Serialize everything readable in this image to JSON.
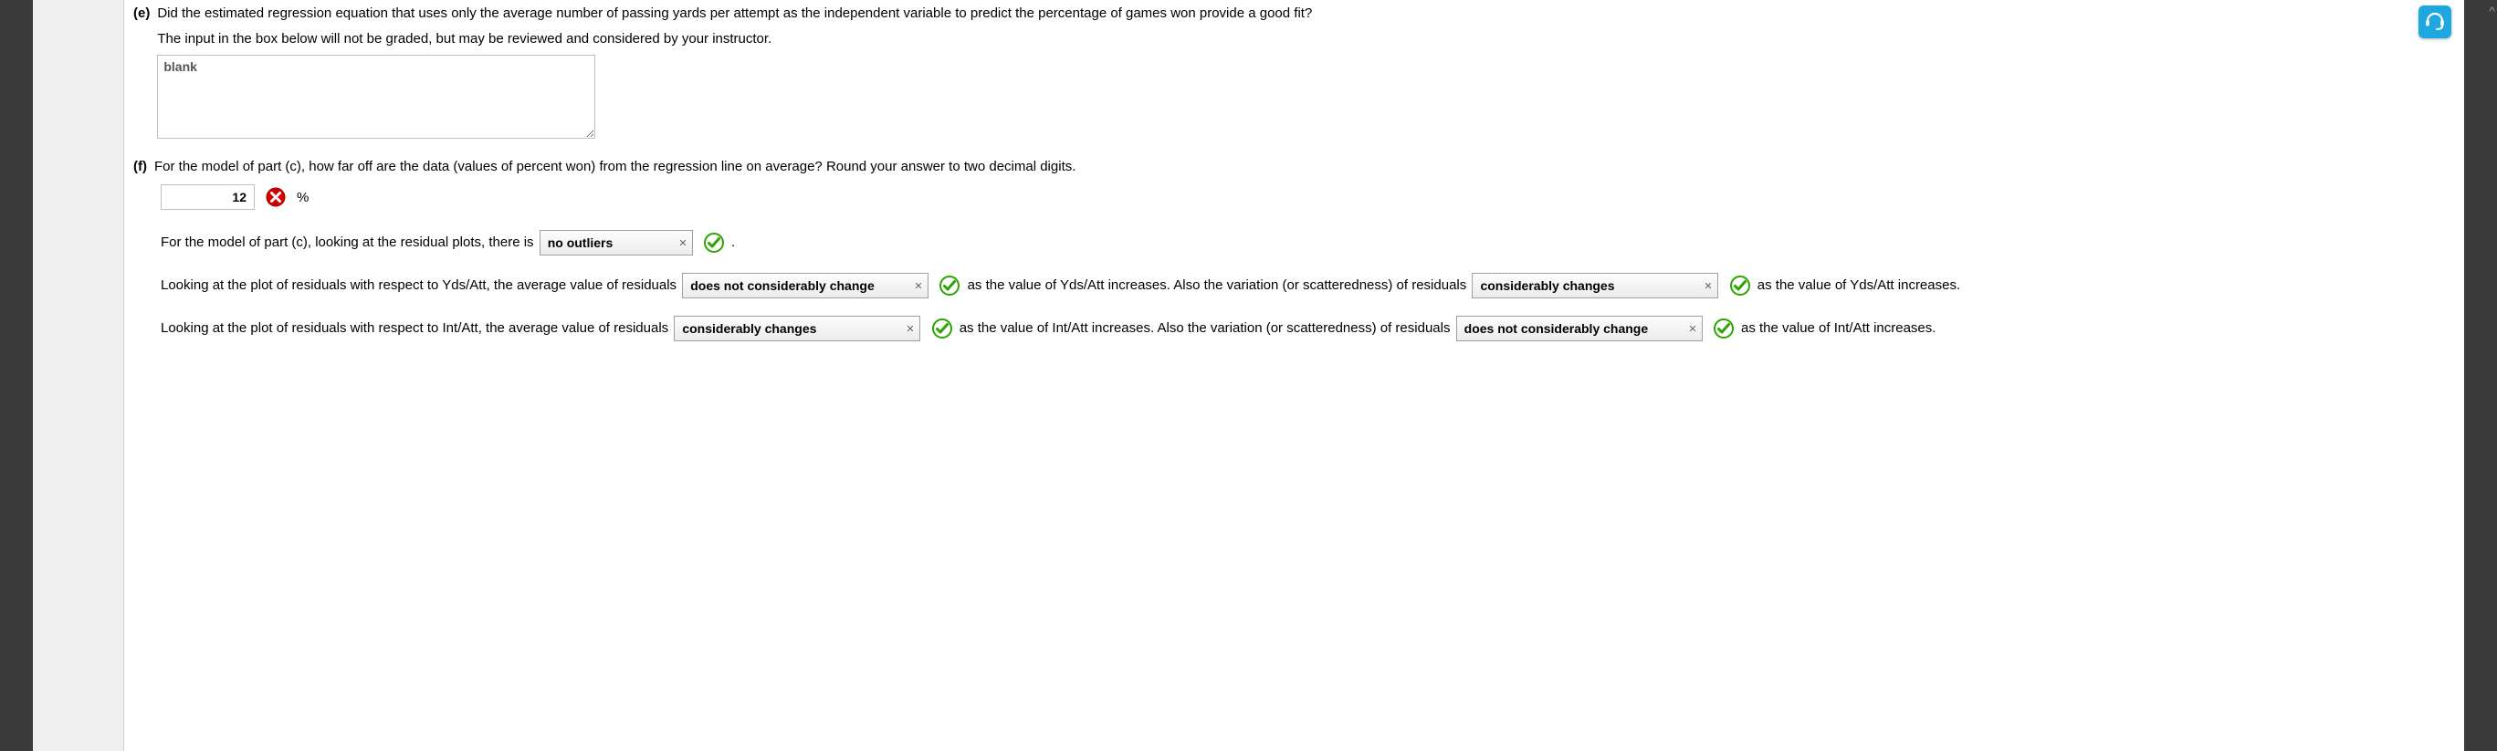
{
  "e": {
    "label": "(e)",
    "question": "Did the estimated regression equation that uses only the average number of passing yards per attempt as the independent variable to predict the percentage of games won provide a good fit?",
    "note": "The input in the box below will not be graded, but may be reviewed and considered by your instructor.",
    "textarea_value": "blank"
  },
  "f": {
    "label": "(f)",
    "question": "For the model of part (c), how far off are the data (values of percent won) from the regression line on average? Round your answer to two decimal digits.",
    "num_value": "12",
    "pct": "%",
    "line1_pre": "For the model of part (c), looking at the residual plots, there is",
    "sel1": "no outliers",
    "line1_post": ".",
    "line2a": "Looking at the plot of residuals with respect to Yds/Att, the average value of residuals",
    "sel2": "does not considerably change",
    "line2b": "as the value of Yds/Att increases. Also the variation (or scatteredness) of residuals",
    "sel3": "considerably changes",
    "line2c": "as the value of Yds/Att increases.",
    "line3a": "Looking at the plot of residuals with respect to Int/Att, the average value of residuals",
    "sel4": "considerably changes",
    "line3b": "as the value of Int/Att increases. Also the variation (or scatteredness) of residuals",
    "sel5": "does not considerably change",
    "line3c": "as the value of Int/Att increases."
  }
}
